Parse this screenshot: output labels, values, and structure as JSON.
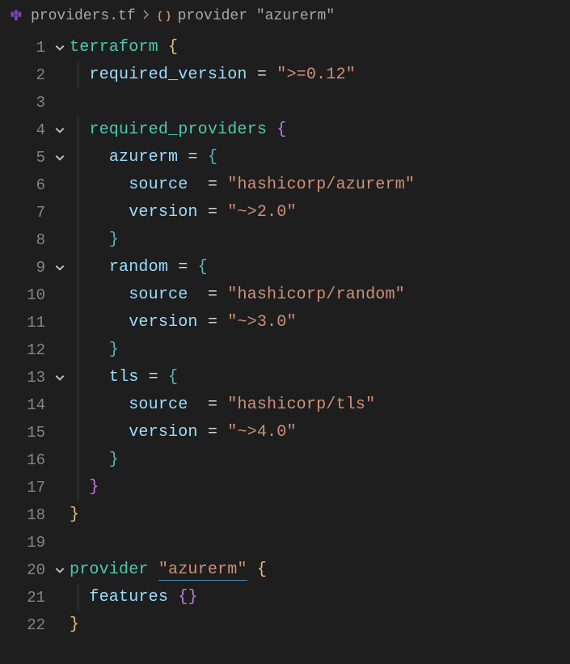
{
  "breadcrumb": {
    "file": "providers.tf",
    "symbol": "provider \"azurerm\""
  },
  "code": {
    "lines": [
      {
        "n": "1",
        "fold": true
      },
      {
        "n": "2",
        "fold": false
      },
      {
        "n": "3",
        "fold": false
      },
      {
        "n": "4",
        "fold": true
      },
      {
        "n": "5",
        "fold": true
      },
      {
        "n": "6",
        "fold": false
      },
      {
        "n": "7",
        "fold": false
      },
      {
        "n": "8",
        "fold": false
      },
      {
        "n": "9",
        "fold": true
      },
      {
        "n": "10",
        "fold": false
      },
      {
        "n": "11",
        "fold": false
      },
      {
        "n": "12",
        "fold": false
      },
      {
        "n": "13",
        "fold": true
      },
      {
        "n": "14",
        "fold": false
      },
      {
        "n": "15",
        "fold": false
      },
      {
        "n": "16",
        "fold": false
      },
      {
        "n": "17",
        "fold": false
      },
      {
        "n": "18",
        "fold": false
      },
      {
        "n": "19",
        "fold": false
      },
      {
        "n": "20",
        "fold": true
      },
      {
        "n": "21",
        "fold": false
      },
      {
        "n": "22",
        "fold": false
      }
    ],
    "tokens": {
      "terraform": "terraform",
      "required_version": "required_version",
      "required_providers": "required_providers",
      "azurerm": "azurerm",
      "random": "random",
      "tls": "tls",
      "source": "source",
      "version": "version",
      "provider": "provider",
      "features": "features",
      "eq": "=",
      "lb": "{",
      "rb": "}",
      "str_tf_version": "\">=0.12\"",
      "str_az_src": "\"hashicorp/azurerm\"",
      "str_az_ver": "\"~>2.0\"",
      "str_rnd_src": "\"hashicorp/random\"",
      "str_rnd_ver": "\"~>3.0\"",
      "str_tls_src": "\"hashicorp/tls\"",
      "str_tls_ver": "\"~>4.0\"",
      "str_provider_az": "\"azurerm\""
    }
  }
}
